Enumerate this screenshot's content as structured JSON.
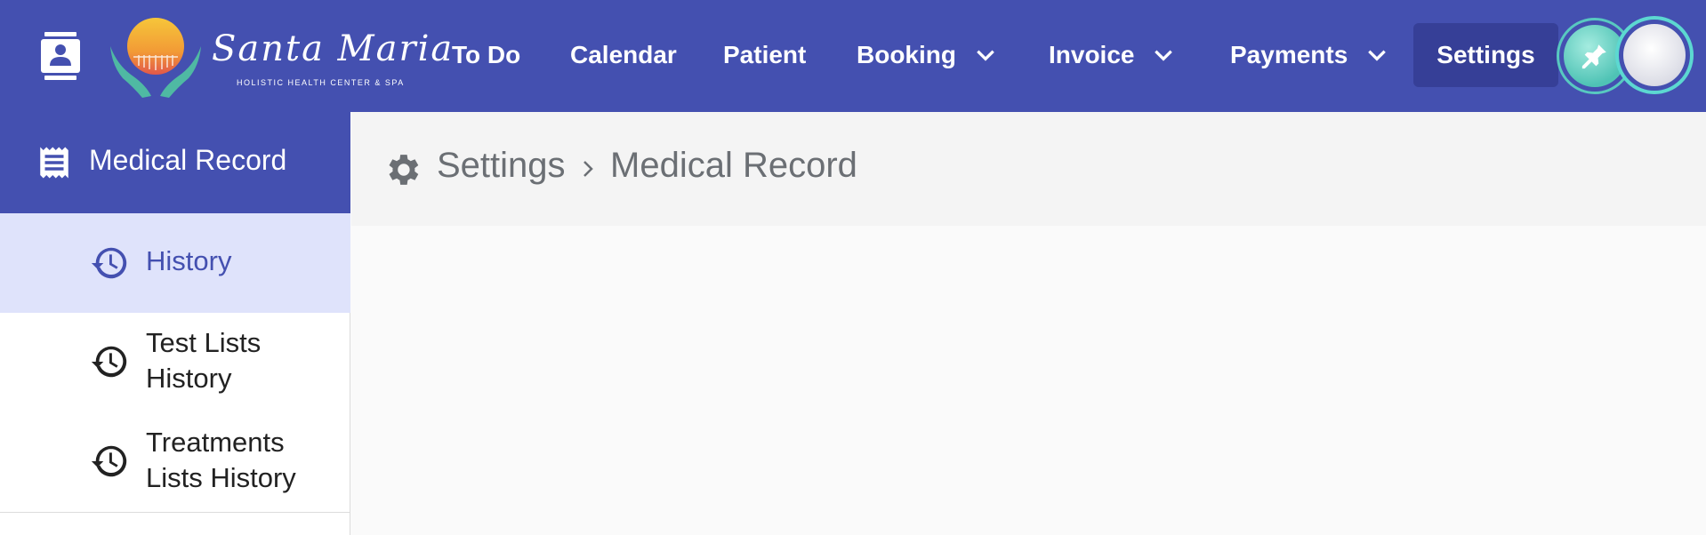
{
  "colors": {
    "primary": "#4450b0",
    "primary_dark": "#363f97",
    "active_bg": "#dfe3fb",
    "accent_teal": "#58c9c0"
  },
  "header": {
    "contact_icon": "contact-card-icon",
    "logo": {
      "name": "Santa Maria",
      "tagline": "HOLISTIC HEALTH CENTER & SPA"
    },
    "nav": [
      {
        "label": "To Do",
        "has_dropdown": false
      },
      {
        "label": "Calendar",
        "has_dropdown": false
      },
      {
        "label": "Patient",
        "has_dropdown": false
      },
      {
        "label": "Booking",
        "has_dropdown": true
      },
      {
        "label": "Invoice",
        "has_dropdown": true
      },
      {
        "label": "Payments",
        "has_dropdown": true
      }
    ],
    "active_nav": "Settings",
    "pin_icon": "pin-icon",
    "avatar_icon": "user-avatar"
  },
  "sidebar": {
    "title": "Medical Record",
    "title_icon": "receipt-icon",
    "items": [
      {
        "label": "History",
        "icon": "history-icon",
        "active": true
      },
      {
        "label": "Test Lists History",
        "icon": "history-icon",
        "active": false
      },
      {
        "label": "Treatments Lists History",
        "icon": "history-icon",
        "active": false
      }
    ]
  },
  "breadcrumb": {
    "icon": "gear-icon",
    "items": [
      "Settings",
      "Medical Record"
    ]
  }
}
